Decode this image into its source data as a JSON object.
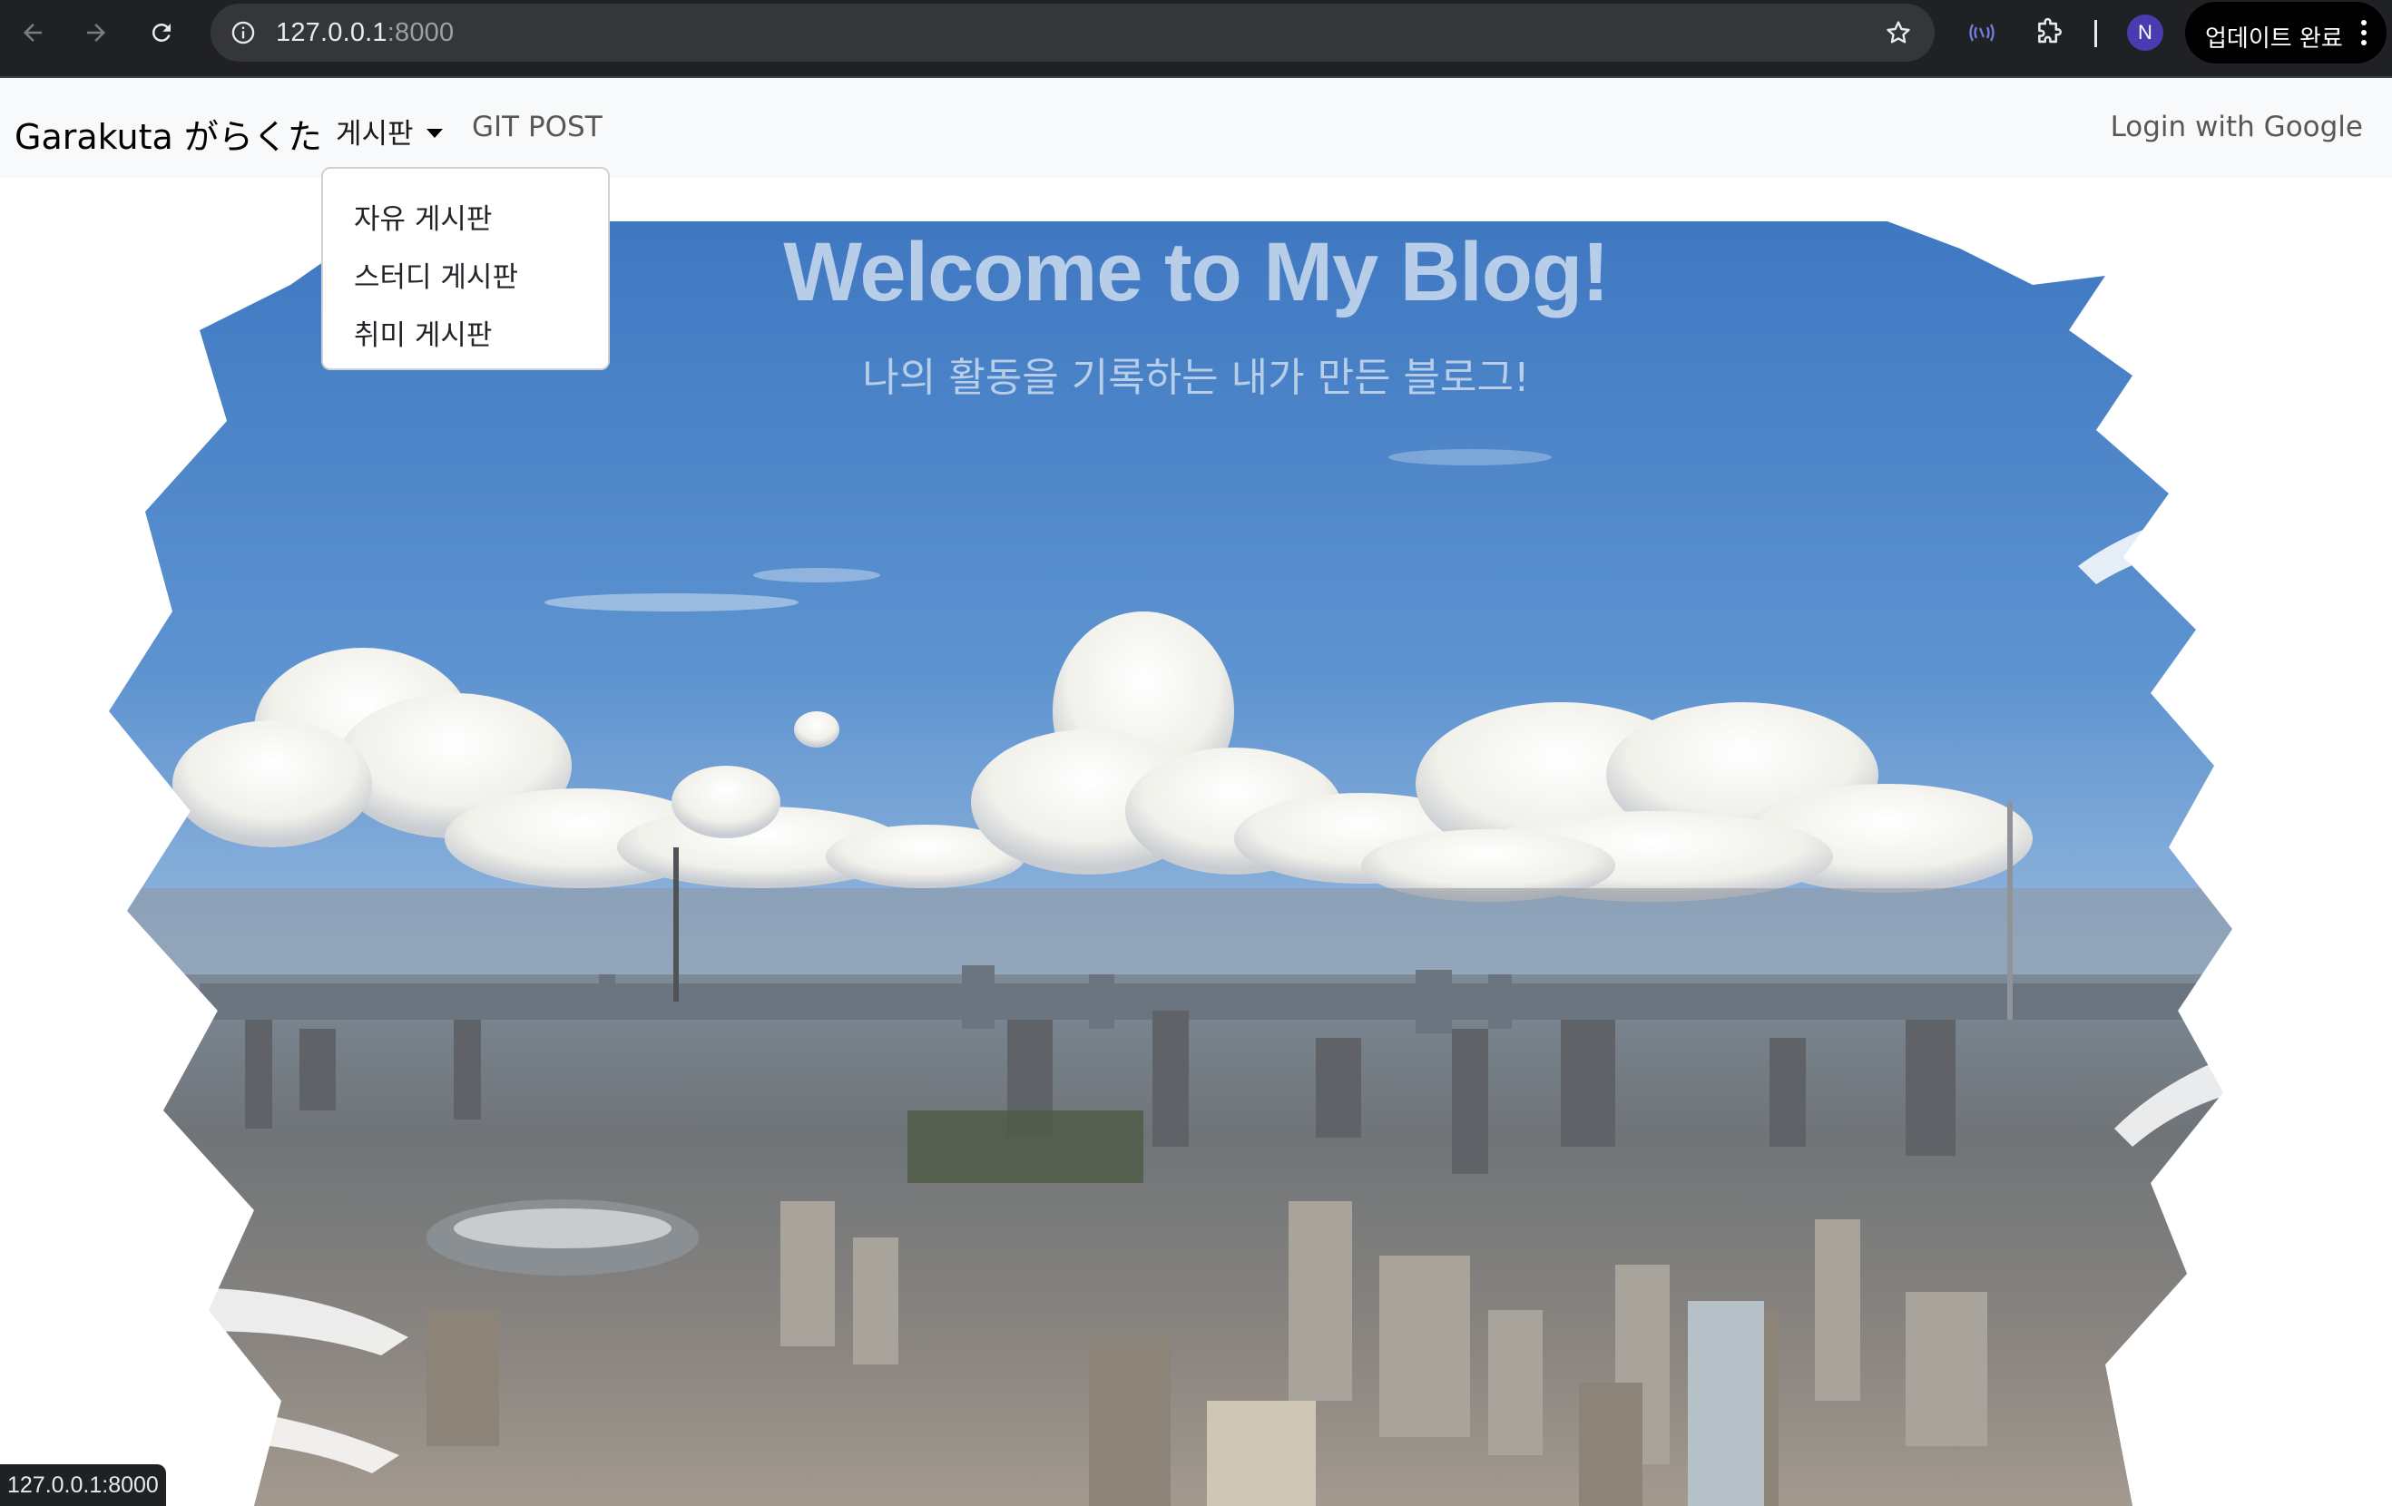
{
  "browser": {
    "url_host": "127.0.0.1",
    "url_port": ":8000",
    "profile_initial": "N",
    "update_label": "업데이트 완료",
    "status_url": "127.0.0.1:8000",
    "icons": [
      "back-arrow-icon",
      "forward-arrow-icon",
      "reload-icon",
      "site-info-icon",
      "bookmark-star-icon",
      "cast-extension-icon",
      "extensions-puzzle-icon",
      "more-menu-icon"
    ]
  },
  "navbar": {
    "brand": "Garakuta がらくた",
    "board_menu": "게시판",
    "git_post": "GIT POST",
    "login": "Login with Google"
  },
  "dropdown": {
    "items": [
      "자유 게시판",
      "스터디 게시판",
      "취미 게시판"
    ]
  },
  "hero": {
    "title": "Welcome to My Blog!",
    "subtitle": "나의 활동을 기록하는 내가 만든 블로그!"
  },
  "colors": {
    "chrome_bg": "#202124",
    "navbar_bg": "#f8f9fa",
    "hero_text": "#b7cde8",
    "profile_bg": "#4a3bb0"
  }
}
